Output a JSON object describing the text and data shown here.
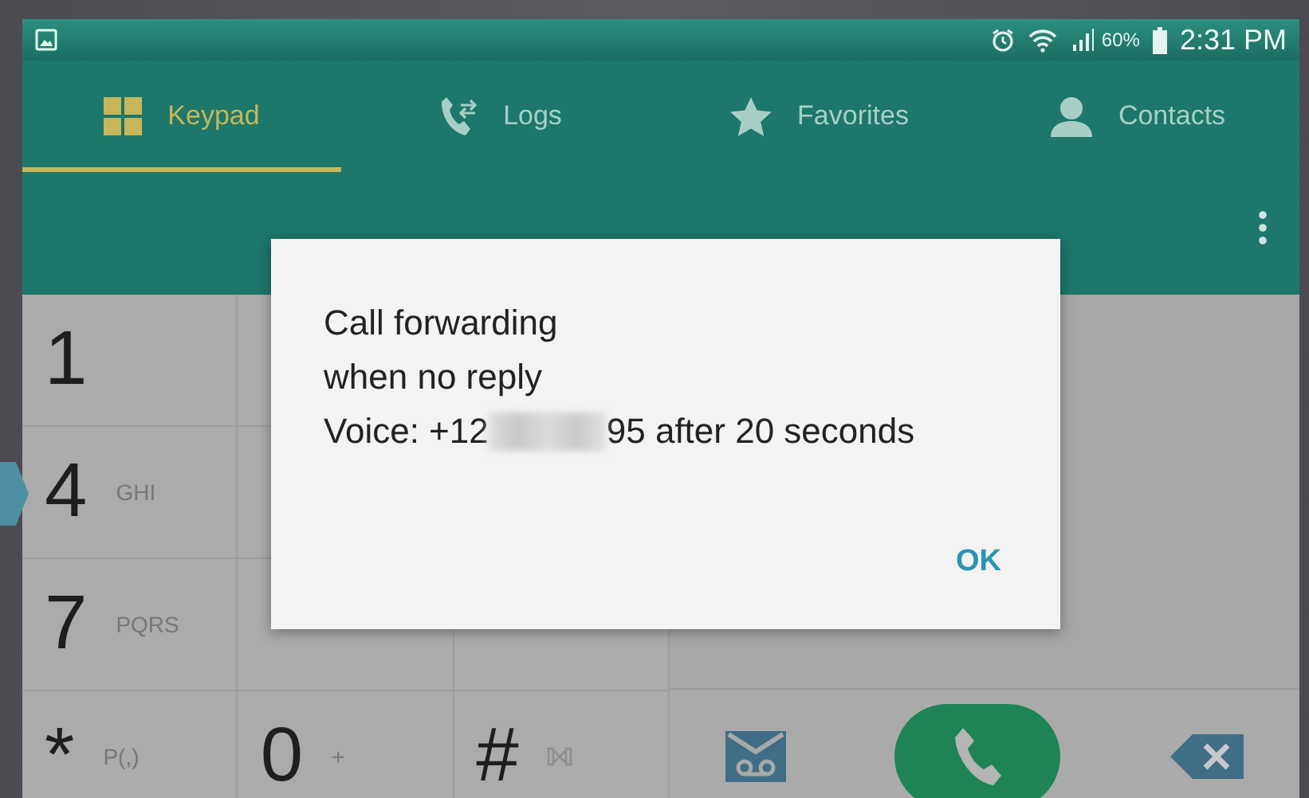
{
  "status_bar": {
    "battery": "60%",
    "time": "2:31 PM"
  },
  "tabs": [
    {
      "label": "Keypad",
      "kind": "keypad",
      "selected": true
    },
    {
      "label": "Logs",
      "kind": "logs",
      "selected": false
    },
    {
      "label": "Favorites",
      "kind": "star",
      "selected": false
    },
    {
      "label": "Contacts",
      "kind": "person",
      "selected": false
    }
  ],
  "keypad": [
    {
      "digit": "1"
    },
    {
      "digit": "4",
      "letters": "GHI"
    },
    {
      "digit": "7",
      "letters": "PQRS"
    },
    {
      "digit": "*",
      "letters": "P(,)"
    },
    {
      "digit": "0",
      "letters": "+"
    },
    {
      "digit": "#"
    }
  ],
  "dialog": {
    "title": "Call forwarding",
    "subtitle": "when no reply",
    "voice_prefix": "Voice: +12",
    "voice_suffix": "95 after 20 seconds",
    "button": "OK"
  }
}
